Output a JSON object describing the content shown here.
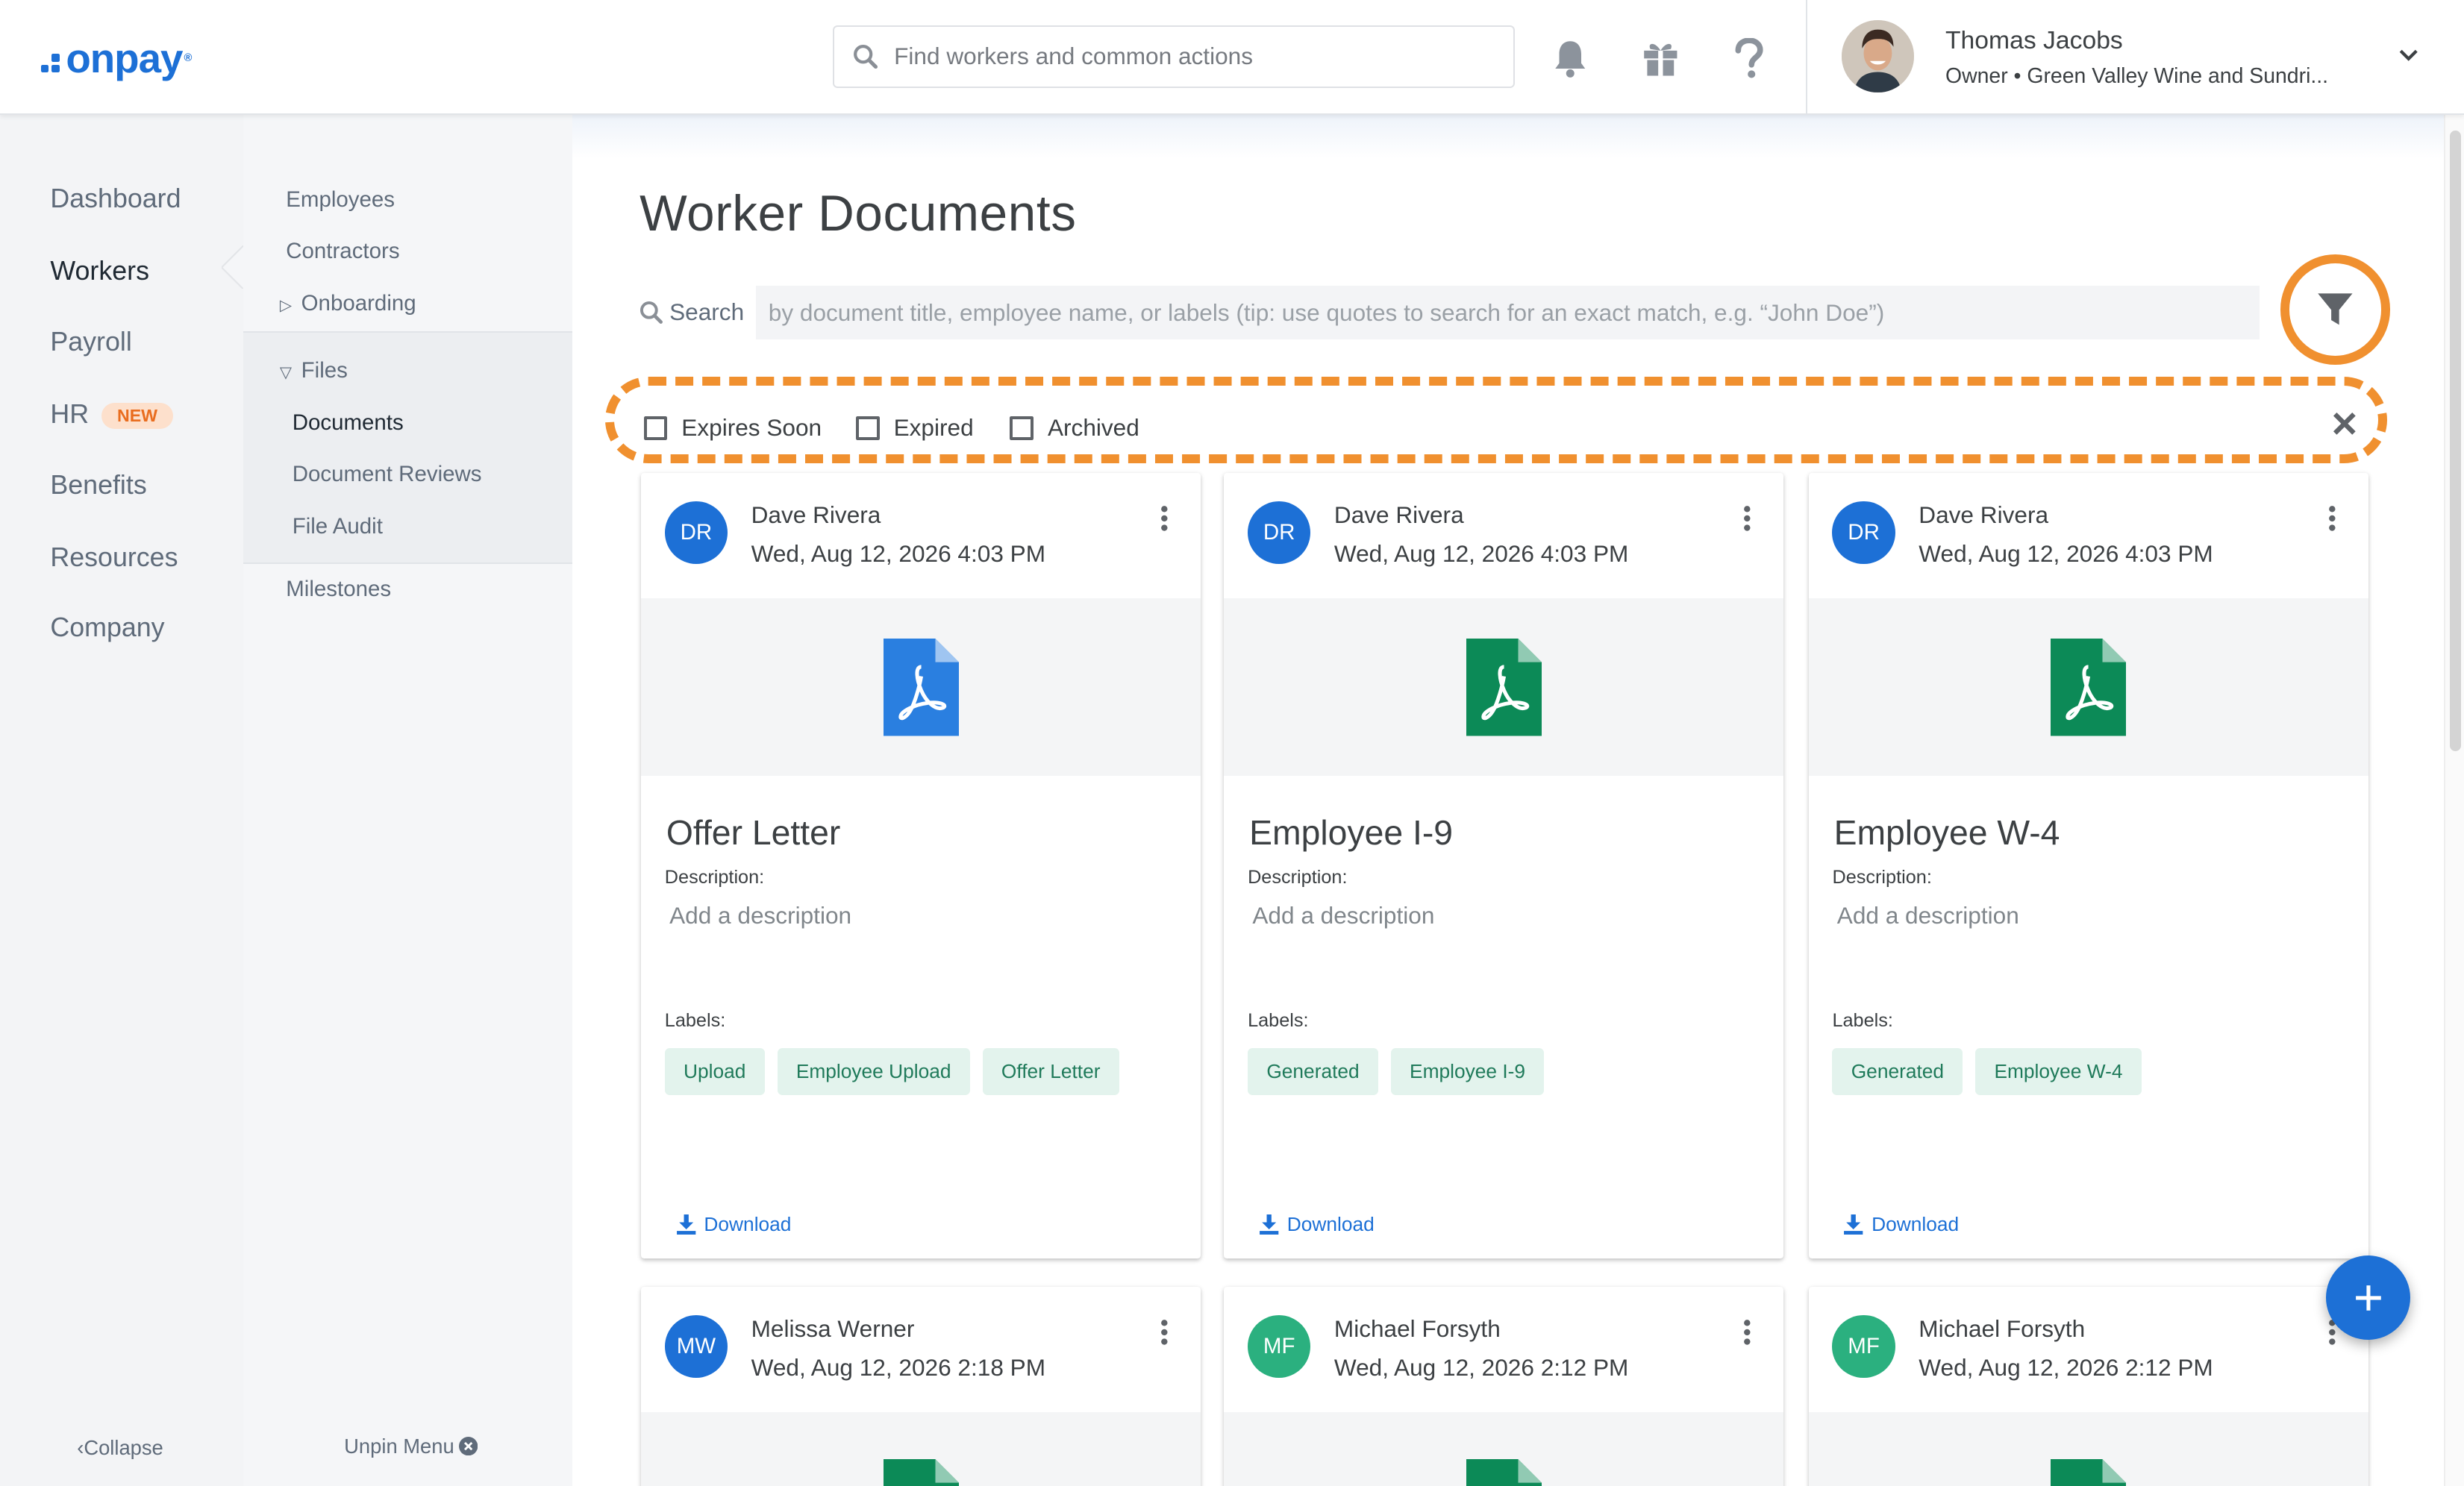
{
  "header": {
    "logo_text": "onpay",
    "logo_reg": "®",
    "search_placeholder": "Find workers and common actions",
    "user": {
      "name": "Thomas Jacobs",
      "role": "Owner • Green Valley Wine and Sundri..."
    },
    "icons": [
      "search-icon",
      "bell-icon",
      "gift-icon",
      "help-icon",
      "chevron-down-icon"
    ]
  },
  "sidebar": {
    "items": [
      {
        "label": "Dashboard"
      },
      {
        "label": "Workers",
        "active": true
      },
      {
        "label": "Payroll"
      },
      {
        "label": "HR",
        "badge": "NEW"
      },
      {
        "label": "Benefits"
      },
      {
        "label": "Resources"
      },
      {
        "label": "Company"
      }
    ],
    "collapse_label": "Collapse"
  },
  "subnav": {
    "items": {
      "employees": "Employees",
      "contractors": "Contractors",
      "onboarding": "Onboarding",
      "files": "Files",
      "documents": "Documents",
      "document_reviews": "Document Reviews",
      "file_audit": "File Audit",
      "milestones": "Milestones"
    },
    "active": "Documents",
    "unpin_label": "Unpin Menu"
  },
  "main": {
    "title": "Worker Documents",
    "search_label": "Search",
    "search_placeholder": "by document title, employee name, or labels (tip: use quotes to search for an exact match, e.g. “John Doe”)",
    "filters": [
      {
        "label": "Expires Soon",
        "checked": false
      },
      {
        "label": "Expired",
        "checked": false
      },
      {
        "label": "Archived",
        "checked": false
      }
    ],
    "description_label": "Description:",
    "labels_label": "Labels:",
    "download_label": "Download",
    "cards": [
      {
        "initials": "DR",
        "name": "Dave Rivera",
        "date": "Wed, Aug 12, 2026 4:03 PM",
        "avatar_color": "#1d70d6",
        "file_color": "#2a7fe0",
        "title": "Offer Letter",
        "description": "Add a description",
        "tags": [
          "Upload",
          "Employee Upload",
          "Offer Letter"
        ]
      },
      {
        "initials": "DR",
        "name": "Dave Rivera",
        "date": "Wed, Aug 12, 2026 4:03 PM",
        "avatar_color": "#1d70d6",
        "file_color": "#0c8a57",
        "title": "Employee I-9",
        "description": "Add a description",
        "tags": [
          "Generated",
          "Employee I-9"
        ]
      },
      {
        "initials": "DR",
        "name": "Dave Rivera",
        "date": "Wed, Aug 12, 2026 4:03 PM",
        "avatar_color": "#1d70d6",
        "file_color": "#0c8a57",
        "title": "Employee W-4",
        "description": "Add a description",
        "tags": [
          "Generated",
          "Employee W-4"
        ]
      },
      {
        "initials": "MW",
        "name": "Melissa Werner",
        "date": "Wed, Aug 12, 2026 2:18 PM",
        "avatar_color": "#1d70d6",
        "file_color": "#0c8a57"
      },
      {
        "initials": "MF",
        "name": "Michael Forsyth",
        "date": "Wed, Aug 12, 2026 2:12 PM",
        "avatar_color": "#2bb07f",
        "file_color": "#0c8a57"
      },
      {
        "initials": "MF",
        "name": "Michael Forsyth",
        "date": "Wed, Aug 12, 2026 2:12 PM",
        "avatar_color": "#2bb07f",
        "file_color": "#0c8a57"
      }
    ]
  },
  "colors": {
    "brand": "#1d70d6",
    "highlight": "#f0902f",
    "tag_bg": "#e3f3ed",
    "tag_text": "#1f7a5a"
  }
}
